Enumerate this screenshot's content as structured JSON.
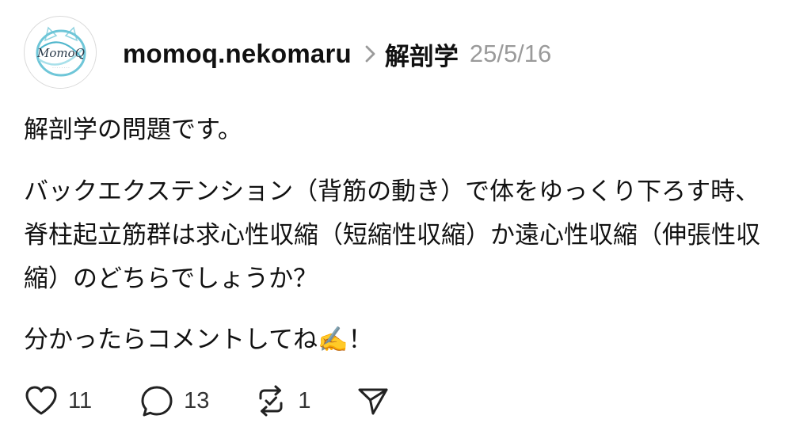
{
  "post": {
    "avatar_text": "MomoQ",
    "username": "momoq.nekomaru",
    "topic": "解剖学",
    "date": "25/5/16",
    "paragraphs": [
      "解剖学の問題です。",
      "バックエクステンション（背筋の動き）で体をゆっくり下ろす時、脊柱起立筋群は求心性収縮（短縮性収縮）か遠心性収縮（伸張性収縮）のどちらでしょうか？",
      "分かったらコメントしてね✍️！"
    ],
    "actions": {
      "likes": "11",
      "replies": "13",
      "reposts": "1"
    },
    "colors": {
      "text": "#111111",
      "muted": "#9a9a9a",
      "avatar_accent": "#6ec6d8"
    },
    "icons": [
      "heart-icon",
      "comment-icon",
      "repost-icon",
      "share-icon",
      "chevron-right-icon"
    ]
  }
}
